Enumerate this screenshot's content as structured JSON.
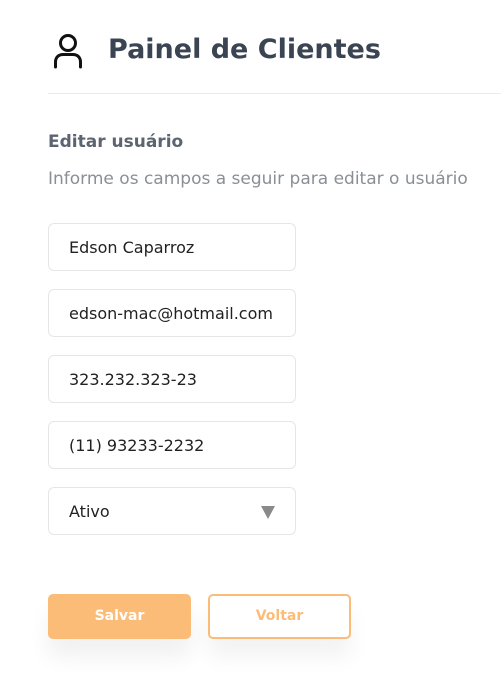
{
  "header": {
    "title": "Painel de Clientes",
    "icon": "user-icon"
  },
  "form": {
    "heading": "Editar usuário",
    "subheading": "Informe os campos a seguir para editar o usuário",
    "fields": {
      "name": "Edson Caparroz",
      "email": "edson-mac@hotmail.com",
      "document": "323.232.323-23",
      "phone": "(11) 93233-2232",
      "status": "Ativo"
    },
    "status_caret_icon": "chevron-down-icon"
  },
  "actions": {
    "save_label": "Salvar",
    "back_label": "Voltar"
  },
  "colors": {
    "accent": "#fbbc78",
    "title": "#3a4452",
    "muted": "#8a8f96"
  }
}
